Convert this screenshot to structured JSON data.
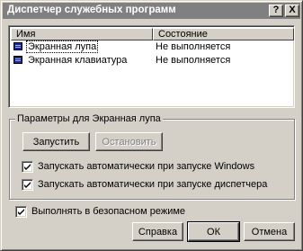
{
  "window": {
    "title": "Диспетчер служебных программ",
    "help_glyph": "?",
    "close_glyph": "X"
  },
  "list": {
    "columns": [
      "Имя",
      "Состояние"
    ],
    "rows": [
      {
        "name": "Экранная лупа",
        "status": "Не выполняется",
        "icon": "app-window-icon",
        "selected": true
      },
      {
        "name": "Экранная клавиатура",
        "status": "Не выполняется",
        "icon": "app-window-icon",
        "selected": false
      }
    ]
  },
  "group": {
    "legend": "Параметры для Экранная лупа",
    "start_label": "Запустить",
    "stop_label": "Остановить",
    "options": [
      {
        "label": "Запускать автоматически при запуске Windows",
        "checked": true
      },
      {
        "label": "Запускать автоматически при запуске диспетчера",
        "checked": true
      }
    ]
  },
  "safe_mode": {
    "label": "Выполнять в безопасном режиме",
    "checked": true
  },
  "footer": {
    "help_label": "Справка",
    "ok_label": "ОК",
    "cancel_label": "Отмена"
  }
}
